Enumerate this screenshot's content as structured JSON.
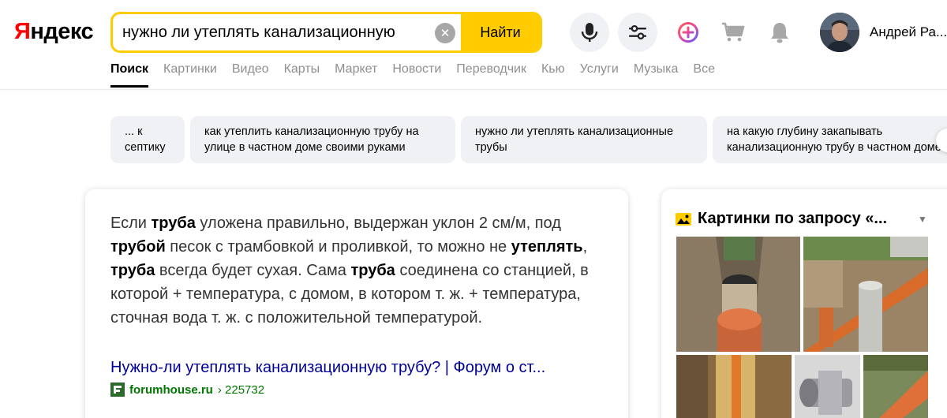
{
  "logo": {
    "first": "Я",
    "rest": "ндекс"
  },
  "search": {
    "query": "нужно ли утеплять канализационную",
    "clear_symbol": "✕",
    "button": "Найти"
  },
  "user": {
    "name": "Андрей Ра..."
  },
  "tabs": [
    "Поиск",
    "Картинки",
    "Видео",
    "Карты",
    "Маркет",
    "Новости",
    "Переводчик",
    "Кью",
    "Услуги",
    "Музыка",
    "Все"
  ],
  "related": [
    "... к септику",
    "как утеплить канализационную трубу на улице в частном доме своими руками",
    "нужно ли утеплять канализационные трубы",
    "на какую глубину закапывать канализационную трубу в частном доме"
  ],
  "result": {
    "link": "Нужно-ли утеплять канализационную трубу? | Форум о ст...",
    "domain": "forumhouse.ru",
    "path": "› 225732",
    "favicon_letter": "F"
  },
  "images": {
    "title": "Картинки по запросу «..."
  },
  "icons": {
    "mic": "microphone-icon",
    "settings": "sliders-icon",
    "plus": "plus-icon",
    "cart": "cart-icon",
    "bell": "bell-icon",
    "images_panel": "image-icon"
  },
  "colors": {
    "accent": "#ffcc00",
    "link": "#000099",
    "url": "#007700",
    "logo_red": "#ff0000"
  }
}
